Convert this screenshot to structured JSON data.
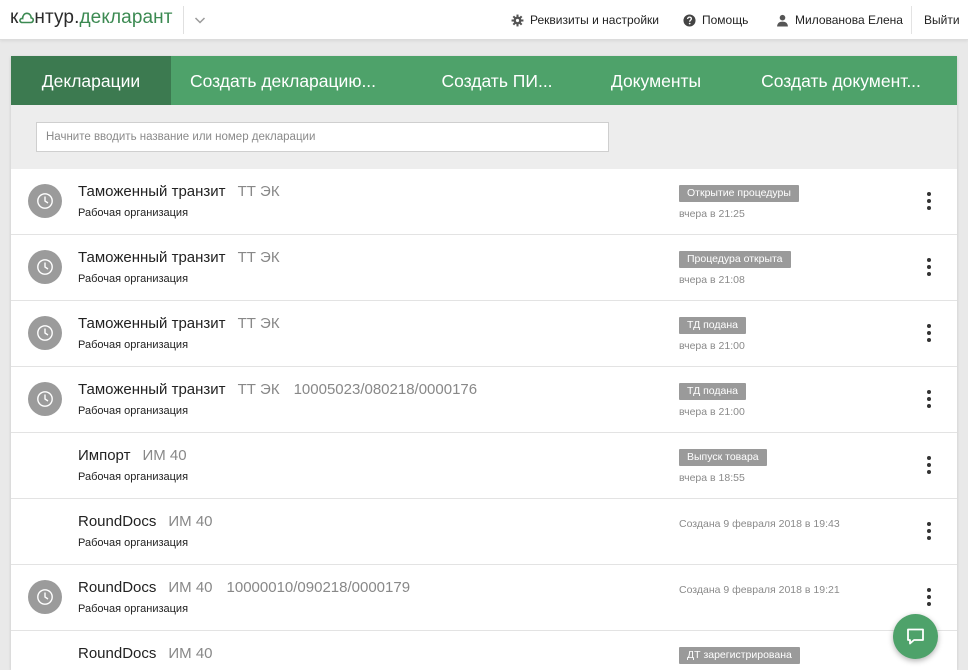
{
  "header": {
    "logo": {
      "prefix": "к",
      "middle": "нтур",
      "dot": ".",
      "suffix": "декларант"
    },
    "product_menu_icon": "chevron-down-icon",
    "settings_label": "Реквизиты и настройки",
    "help_label": "Помощь",
    "user_name": "Милованова Елена",
    "logout_label": "Выйти"
  },
  "tabs": [
    {
      "label": "Декларации",
      "active": true
    },
    {
      "label": "Создать декларацию..."
    },
    {
      "label": "Создать ПИ..."
    },
    {
      "label": "Документы"
    },
    {
      "label": "Создать документ..."
    }
  ],
  "search": {
    "placeholder": "Начните вводить название или номер декларации",
    "value": ""
  },
  "declarations": [
    {
      "title": "Таможенный транзит",
      "kind": "ТТ ЭК",
      "number": "",
      "org": "Рабочая организация",
      "status": "Открытие процедуры",
      "time": "вчера в 21:25",
      "has_icon": true
    },
    {
      "title": "Таможенный транзит",
      "kind": "ТТ ЭК",
      "number": "",
      "org": "Рабочая организация",
      "status": "Процедура открыта",
      "time": "вчера в 21:08",
      "has_icon": true
    },
    {
      "title": "Таможенный транзит",
      "kind": "ТТ ЭК",
      "number": "",
      "org": "Рабочая организация",
      "status": "ТД подана",
      "time": "вчера в 21:00",
      "has_icon": true
    },
    {
      "title": "Таможенный транзит",
      "kind": "ТТ ЭК",
      "number": "10005023/080218/0000176",
      "org": "Рабочая организация",
      "status": "ТД подана",
      "time": "вчера в 21:00",
      "has_icon": true
    },
    {
      "title": "Импорт",
      "kind": "ИМ 40",
      "number": "",
      "org": "Рабочая организация",
      "status": "Выпуск товара",
      "time": "вчера в 18:55",
      "has_icon": false
    },
    {
      "title": "RoundDocs",
      "kind": "ИМ 40",
      "number": "",
      "org": "Рабочая организация",
      "status": "",
      "time": "Создана 9 февраля 2018 в 19:43",
      "has_icon": false
    },
    {
      "title": "RoundDocs",
      "kind": "ИМ 40",
      "number": "10000010/090218/0000179",
      "org": "Рабочая организация",
      "status": "",
      "time": "Создана 9 февраля 2018 в 19:21",
      "has_icon": true
    },
    {
      "title": "RoundDocs",
      "kind": "ИМ 40",
      "number": "",
      "org": "",
      "status": "ДТ зарегистрирована",
      "time": "",
      "has_icon": false
    }
  ],
  "icons": {
    "status": "clock-icon",
    "row_menu": "more-vertical-icon",
    "settings": "gear-icon",
    "help": "help-circle-icon",
    "user": "user-icon",
    "chat": "chat-bubble-icon"
  },
  "colors": {
    "accent_green": "#4ea26a",
    "active_tab": "#3c7a50",
    "status_badge": "#9a9a9a",
    "icon_gray": "#9b9b9b"
  }
}
